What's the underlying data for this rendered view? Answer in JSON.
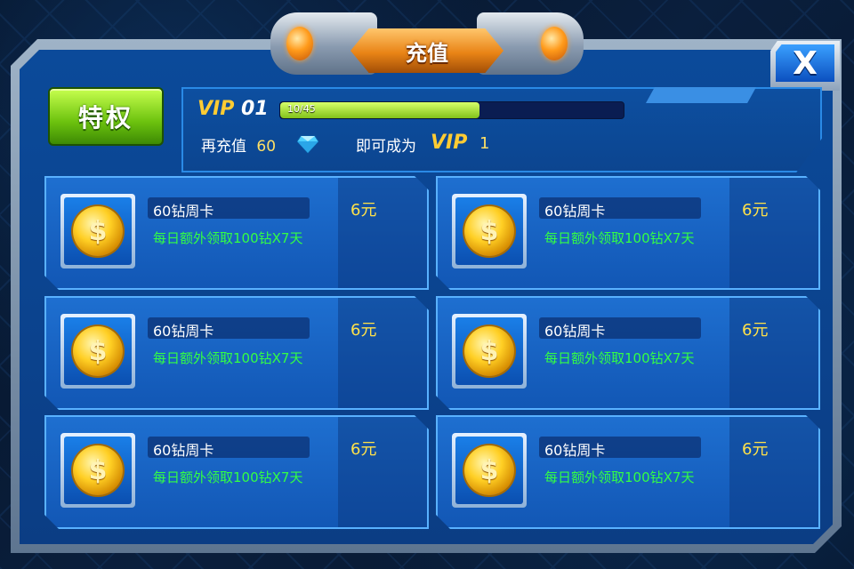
{
  "title": "充值",
  "close_label": "X",
  "privilege_label": "特权",
  "vip": {
    "prefix": "VIP",
    "level": "01",
    "progress_text": "10/45",
    "progress_fraction": 0.58,
    "recharge_prefix": "再充值",
    "recharge_amount": "60",
    "become_text": "即可成为",
    "next_vip_prefix": "VIP",
    "next_vip_level": "1"
  },
  "cards": [
    {
      "title": "60钻周卡",
      "desc": "每日额外领取100钻X7天",
      "price": "6元"
    },
    {
      "title": "60钻周卡",
      "desc": "每日额外领取100钻X7天",
      "price": "6元"
    },
    {
      "title": "60钻周卡",
      "desc": "每日额外领取100钻X7天",
      "price": "6元"
    },
    {
      "title": "60钻周卡",
      "desc": "每日额外领取100钻X7天",
      "price": "6元"
    },
    {
      "title": "60钻周卡",
      "desc": "每日额外领取100钻X7天",
      "price": "6元"
    },
    {
      "title": "60钻周卡",
      "desc": "每日额外领取100钻X7天",
      "price": "6元"
    }
  ],
  "colors": {
    "accent": "#ffcc33",
    "desc_green": "#33ff44",
    "panel_blue": "#1257b5"
  },
  "icons": {
    "coin": "gold-coin-icon",
    "gem": "diamond-gem-icon",
    "close": "close-icon"
  }
}
